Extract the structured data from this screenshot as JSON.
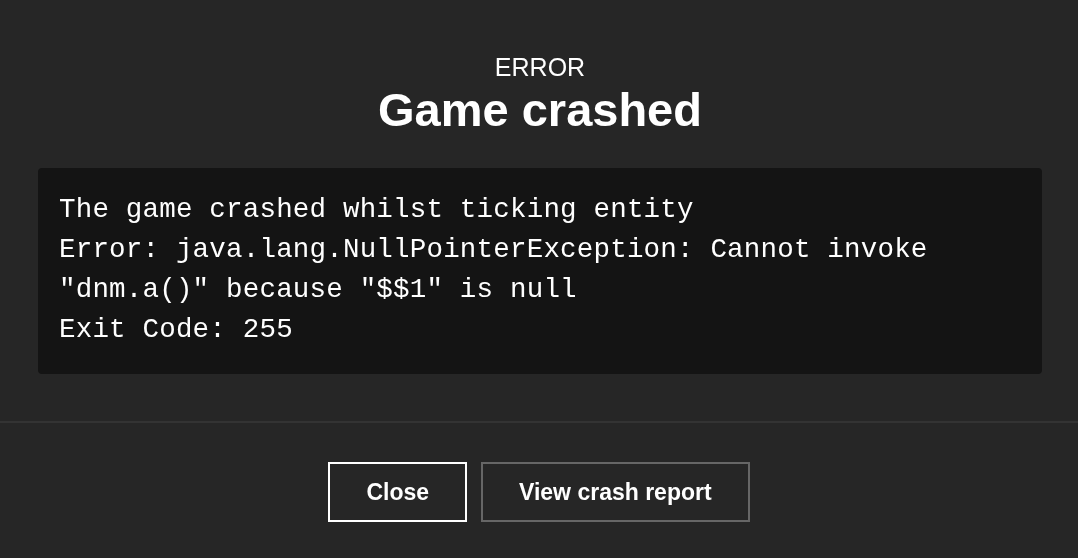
{
  "dialog": {
    "overline": "ERROR",
    "title": "Game crashed",
    "log_lines": [
      "The game crashed whilst ticking entity",
      "Error: java.lang.NullPointerException: Cannot invoke \"dnm.a()\" because \"$$1\" is null",
      "Exit Code: 255"
    ],
    "buttons": [
      {
        "label": "Close",
        "focused": true
      },
      {
        "label": "View crash report",
        "focused": false
      }
    ]
  }
}
